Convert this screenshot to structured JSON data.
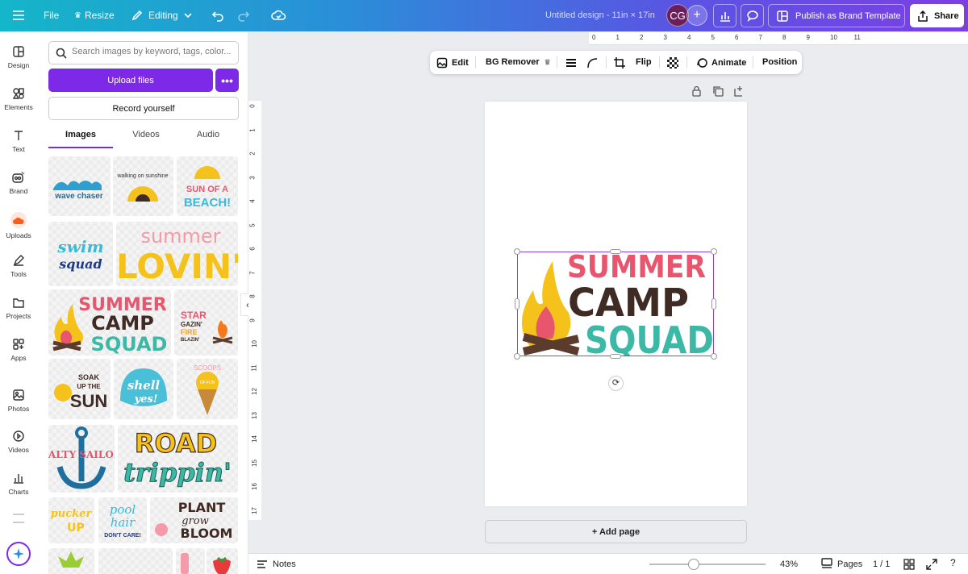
{
  "topbar": {
    "file_label": "File",
    "resize_label": "Resize",
    "editing_label": "Editing",
    "doc_title": "Untitled design - 11in × 17in",
    "avatar_initials": "CG",
    "publish_label": "Publish as Brand Template",
    "share_label": "Share"
  },
  "rail": {
    "items": [
      {
        "label": "Design",
        "icon": "layout-icon"
      },
      {
        "label": "Elements",
        "icon": "shapes-icon"
      },
      {
        "label": "Text",
        "icon": "text-icon"
      },
      {
        "label": "Brand",
        "icon": "brand-icon"
      },
      {
        "label": "Uploads",
        "icon": "cloud-upload-icon"
      },
      {
        "label": "Tools",
        "icon": "pen-icon"
      },
      {
        "label": "Projects",
        "icon": "folder-icon"
      },
      {
        "label": "Apps",
        "icon": "apps-icon"
      },
      {
        "label": "Photos",
        "icon": "image-icon"
      },
      {
        "label": "Videos",
        "icon": "play-icon"
      },
      {
        "label": "Charts",
        "icon": "chart-icon"
      }
    ]
  },
  "panel": {
    "search_placeholder": "Search images by keyword, tags, color...",
    "upload_label": "Upload files",
    "more_label": "•••",
    "record_label": "Record yourself",
    "tabs": [
      "Images",
      "Videos",
      "Audio"
    ],
    "thumbs": {
      "wave": "wave chaser",
      "walking": "walking on sunshine",
      "sun_beach_1": "SUN OF A",
      "sun_beach_2": "BEACH!",
      "swim_1": "swim",
      "swim_2": "squad",
      "lovin_1": "summer",
      "lovin_2": "LOVIN'",
      "camp_1": "SUMMER",
      "camp_2": "CAMP",
      "camp_3": "SQUAD",
      "star_1": "STAR",
      "star_2": "GAZIN'",
      "star_3": "FIRE",
      "star_4": "BLAZIN'",
      "soak_1": "SOAK",
      "soak_2": "UP THE",
      "soak_3": "SUN",
      "shell_1": "shell",
      "shell_2": "yes!",
      "scoops_1": "SCOOPS",
      "scoops_2": "OF FUN",
      "salty": "SALTY SAILOR",
      "road_1": "ROAD",
      "road_2": "trippin'",
      "pucker_1": "pucker",
      "pucker_2": "UP",
      "pool_1": "pool",
      "pool_2": "hair",
      "pool_3": "DON'T CARE!",
      "plant_1": "PLANT",
      "plant_2": "grow",
      "plant_3": "BLOOM"
    }
  },
  "rulers": {
    "h_ticks": [
      "0",
      "1",
      "2",
      "3",
      "4",
      "5",
      "6",
      "7",
      "8",
      "9",
      "10",
      "11"
    ],
    "v_ticks": [
      "0",
      "1",
      "2",
      "3",
      "4",
      "5",
      "6",
      "7",
      "8",
      "9",
      "10",
      "11",
      "12",
      "13",
      "14",
      "15",
      "16",
      "17"
    ]
  },
  "context_toolbar": {
    "edit_label": "Edit",
    "bg_remover_label": "BG Remover",
    "flip_label": "Flip",
    "animate_label": "Animate",
    "position_label": "Position"
  },
  "canvas": {
    "graphic_line_1": "SUMMER",
    "graphic_line_2": "CAMP",
    "graphic_line_3": "SQUAD",
    "add_page_label": "+ Add page"
  },
  "bottombar": {
    "notes_label": "Notes",
    "zoom_label": "43%",
    "zoom_fraction": 0.38,
    "pages_label": "Pages",
    "page_count": "1 / 1"
  },
  "colors": {
    "accent": "#7d2ae8",
    "summer_pink": "#e8566e",
    "camp_brown": "#3f2a24",
    "squad_teal": "#3cb9a6",
    "flame_yellow": "#f5c21b"
  }
}
